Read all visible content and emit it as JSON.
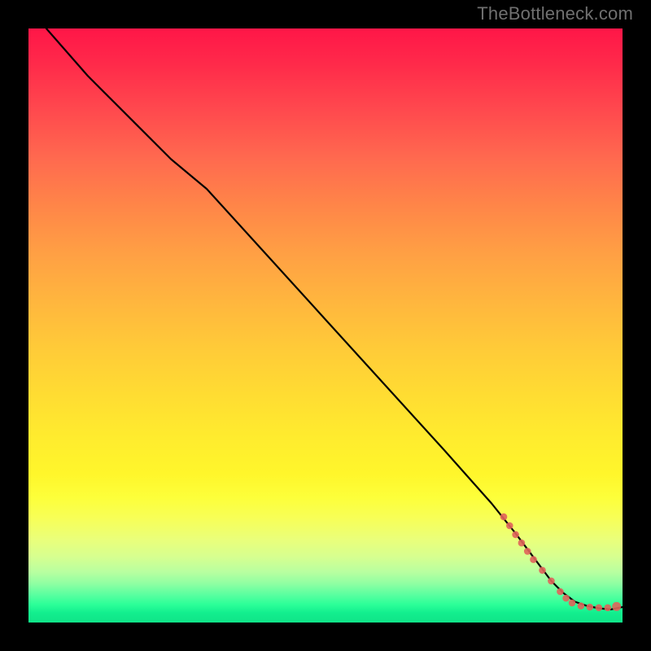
{
  "watermark": "TheBottleneck.com",
  "chart_data": {
    "type": "line",
    "title": "",
    "xlabel": "",
    "ylabel": "",
    "xlim": [
      0,
      100
    ],
    "ylim": [
      0,
      100
    ],
    "grid": false,
    "legend": false,
    "series": [
      {
        "name": "bottleneck-curve",
        "color": "#000000",
        "style": "line",
        "x": [
          3,
          10,
          18,
          24,
          30,
          40,
          50,
          60,
          70,
          78,
          82,
          85,
          88,
          90,
          92,
          94,
          96,
          98,
          100
        ],
        "values": [
          100,
          92,
          84,
          78,
          73,
          62,
          51,
          40,
          29,
          20,
          15,
          11,
          7,
          5,
          3.5,
          2.8,
          2.4,
          2.2,
          2.6
        ]
      },
      {
        "name": "red-dots",
        "color": "#e0645a",
        "style": "scatter",
        "x": [
          80,
          81,
          82,
          83,
          84,
          85,
          86.5,
          88,
          89.5,
          90.5,
          91.5,
          93,
          94.5,
          96,
          97.5,
          99
        ],
        "values": [
          17.8,
          16.3,
          14.8,
          13.4,
          12.0,
          10.6,
          8.8,
          7.0,
          5.2,
          4.1,
          3.3,
          2.8,
          2.6,
          2.5,
          2.5,
          2.7
        ]
      }
    ]
  }
}
